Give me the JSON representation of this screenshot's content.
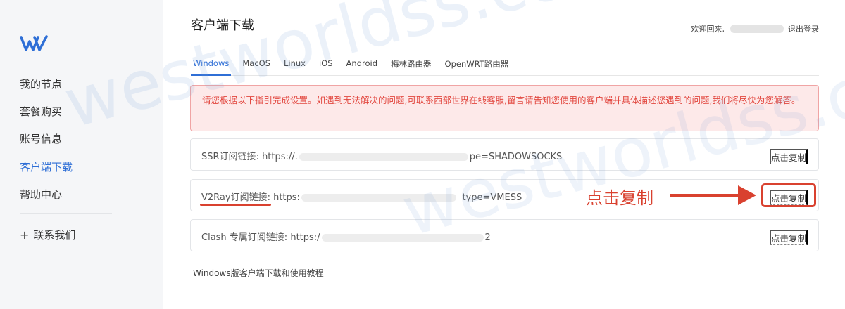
{
  "sidebar": {
    "items": [
      {
        "label": "我的节点"
      },
      {
        "label": "套餐购买"
      },
      {
        "label": "账号信息"
      },
      {
        "label": "客户端下载"
      },
      {
        "label": "帮助中心"
      },
      {
        "label": "联系我们"
      }
    ],
    "contact_plus": "+"
  },
  "header": {
    "title": "客户端下载",
    "welcome": "欢迎回来,",
    "logout": "退出登录"
  },
  "tabs": [
    {
      "label": "Windows"
    },
    {
      "label": "MacOS"
    },
    {
      "label": "Linux"
    },
    {
      "label": "iOS"
    },
    {
      "label": "Android"
    },
    {
      "label": "梅林路由器"
    },
    {
      "label": "OpenWRT路由器"
    }
  ],
  "alert": {
    "text": "请您根据以下指引完成设置。如遇到无法解决的问题,可联系西部世界在线客服,留言请告知您使用的客户端并具体描述您遇到的问题,我们将尽快为您解答。"
  },
  "links": [
    {
      "label": "SSR订阅链接:",
      "url_start": "https://.",
      "url_end": "pe=SHADOWSOCKS",
      "copy": "点击复制"
    },
    {
      "label": "V2Ray订阅链接:",
      "url_start": "https:",
      "url_end": "_type=VMESS",
      "copy": "点击复制"
    },
    {
      "label": "Clash 专属订阅链接:",
      "url_start": "https:/",
      "url_end": "2",
      "copy": "点击复制"
    }
  ],
  "annotation": {
    "callout": "点击复制"
  },
  "tutorial": "Windows版客户端下载和使用教程",
  "watermark": "westworldss.com",
  "colors": {
    "accent": "#2f6fd6",
    "alert_text": "#e2473f",
    "annotation": "#d9412f"
  }
}
